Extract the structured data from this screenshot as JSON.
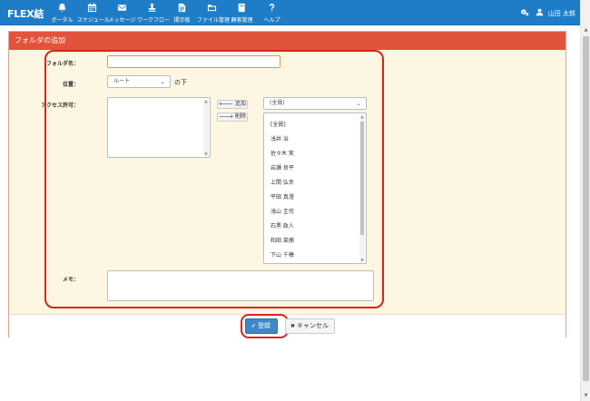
{
  "app": {
    "brand": "FLEX結"
  },
  "nav": [
    {
      "label": "ポータル",
      "icon": "bell-icon"
    },
    {
      "label": "スケジュール",
      "icon": "calendar-icon"
    },
    {
      "label": "メッセージ",
      "icon": "envelope-icon"
    },
    {
      "label": "ワークフロー",
      "icon": "stamp-icon"
    },
    {
      "label": "掲示板",
      "icon": "board-icon"
    },
    {
      "label": "ファイル管理",
      "icon": "folder-icon"
    },
    {
      "label": "顧客管理",
      "icon": "book-icon"
    },
    {
      "label": "ヘルプ",
      "icon": "question-icon"
    }
  ],
  "user": {
    "name": "山田 太郎"
  },
  "panel": {
    "title": "フォルダの追加"
  },
  "form": {
    "folder_name_label": "フォルダ名：",
    "folder_name_value": "",
    "location_label": "位置：",
    "location_value": "ルート",
    "location_suffix": "の下",
    "access_label": "アクセス許可：",
    "add_label": "追加",
    "remove_label": "削除",
    "group_select_value": "(全員)",
    "members": [
      "[全員]",
      "浅井 治",
      "佐々木 実",
      "岩瀬 良平",
      "上間 弘幸",
      "平田 真澄",
      "浅山 圭司",
      "石黒 政人",
      "和田 菜摘",
      "下山 千穂"
    ],
    "memo_label": "メモ：",
    "memo_value": ""
  },
  "actions": {
    "register_label": "登録",
    "cancel_label": "キャンセル"
  },
  "colors": {
    "nav": "#1f7dc7",
    "header": "#e2533b",
    "highlight": "#d9231e",
    "primary": "#3f87c7"
  }
}
